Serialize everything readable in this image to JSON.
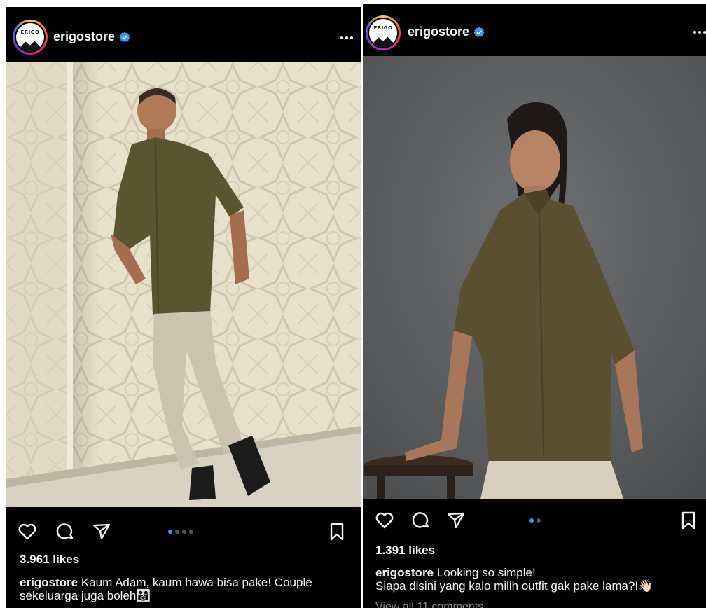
{
  "posts": [
    {
      "username": "erigostore",
      "avatar_text": "ERIGO",
      "likes": "3.961 likes",
      "caption_user": "erigostore",
      "caption_line1": "Kaum Adam, kaum hawa bisa pake! Couple",
      "caption_line2": "sekeluarga juga boleh",
      "caption_emoji": "👨‍👩‍👧",
      "carousel": {
        "count": 4,
        "active_index": 0
      },
      "icons": [
        "heart-icon",
        "comment-icon",
        "share-icon",
        "bookmark-icon",
        "more-icon",
        "verified-icon"
      ]
    },
    {
      "username": "erigostore",
      "avatar_text": "ERIGO",
      "likes": "1.391 likes",
      "caption_user": "erigostore",
      "caption_line1": "Looking so simple!",
      "caption_line2": "Siapa disini yang kalo milih outfit gak pake lama?!",
      "caption_emoji": "👋🏻",
      "comments_link": "View all 11 comments",
      "carousel": {
        "count": 2,
        "active_index": 0
      },
      "icons": [
        "heart-icon",
        "comment-icon",
        "share-icon",
        "bookmark-icon",
        "more-icon",
        "verified-icon"
      ]
    }
  ],
  "colors": {
    "background": "#000000",
    "text": "#f5f5f5",
    "verified": "#3897f0",
    "dot_active": "#3897f0",
    "dot_inactive": "#555555",
    "muted": "#8e8e8e"
  }
}
